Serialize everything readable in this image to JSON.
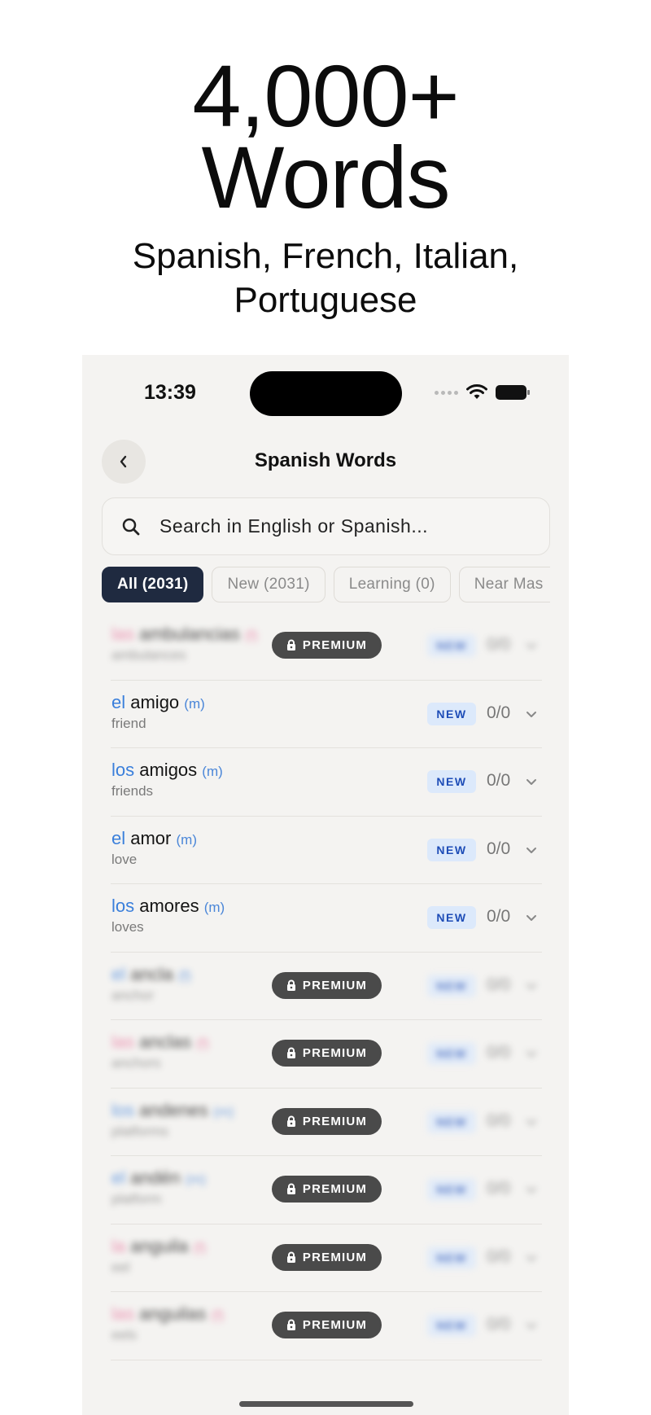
{
  "headline": {
    "line1": "4,000+",
    "line2": "Words",
    "subtitle_line1": "Spanish, French, Italian,",
    "subtitle_line2": "Portuguese"
  },
  "status_bar": {
    "time": "13:39",
    "icons": [
      "cellular-dots-icon",
      "wifi-icon",
      "battery-icon"
    ]
  },
  "nav": {
    "back_icon": "chevron-left-icon",
    "title": "Spanish Words"
  },
  "search": {
    "icon": "search-icon",
    "placeholder": "Search in English or Spanish..."
  },
  "filters": [
    {
      "label": "All (2031)",
      "active": true
    },
    {
      "label": "New (2031)",
      "active": false
    },
    {
      "label": "Learning (0)",
      "active": false
    },
    {
      "label": "Near Mas",
      "active": false
    }
  ],
  "premium_label": "PREMIUM",
  "words": [
    {
      "locked": true,
      "article": "las",
      "word": "ambulancias",
      "gender": "(f)",
      "fem": true,
      "translation": "ambulances",
      "badge": "NEW",
      "count": "0/0"
    },
    {
      "locked": false,
      "article": "el",
      "word": "amigo",
      "gender": "(m)",
      "fem": false,
      "translation": "friend",
      "badge": "NEW",
      "count": "0/0"
    },
    {
      "locked": false,
      "article": "los",
      "word": "amigos",
      "gender": "(m)",
      "fem": false,
      "translation": "friends",
      "badge": "NEW",
      "count": "0/0"
    },
    {
      "locked": false,
      "article": "el",
      "word": "amor",
      "gender": "(m)",
      "fem": false,
      "translation": "love",
      "badge": "NEW",
      "count": "0/0"
    },
    {
      "locked": false,
      "article": "los",
      "word": "amores",
      "gender": "(m)",
      "fem": false,
      "translation": "loves",
      "badge": "NEW",
      "count": "0/0"
    },
    {
      "locked": true,
      "article": "el",
      "word": "ancla",
      "gender": "(f)",
      "fem": false,
      "translation": "anchor",
      "badge": "NEW",
      "count": "0/0"
    },
    {
      "locked": true,
      "article": "las",
      "word": "anclas",
      "gender": "(f)",
      "fem": true,
      "translation": "anchors",
      "badge": "NEW",
      "count": "0/0"
    },
    {
      "locked": true,
      "article": "los",
      "word": "andenes",
      "gender": "(m)",
      "fem": false,
      "translation": "platforms",
      "badge": "NEW",
      "count": "0/0"
    },
    {
      "locked": true,
      "article": "el",
      "word": "andén",
      "gender": "(m)",
      "fem": false,
      "translation": "platform",
      "badge": "NEW",
      "count": "0/0"
    },
    {
      "locked": true,
      "article": "la",
      "word": "anguila",
      "gender": "(f)",
      "fem": true,
      "translation": "eel",
      "badge": "NEW",
      "count": "0/0"
    },
    {
      "locked": true,
      "article": "las",
      "word": "anguilas",
      "gender": "(f)",
      "fem": true,
      "translation": "eels",
      "badge": "NEW",
      "count": "0/0"
    }
  ]
}
